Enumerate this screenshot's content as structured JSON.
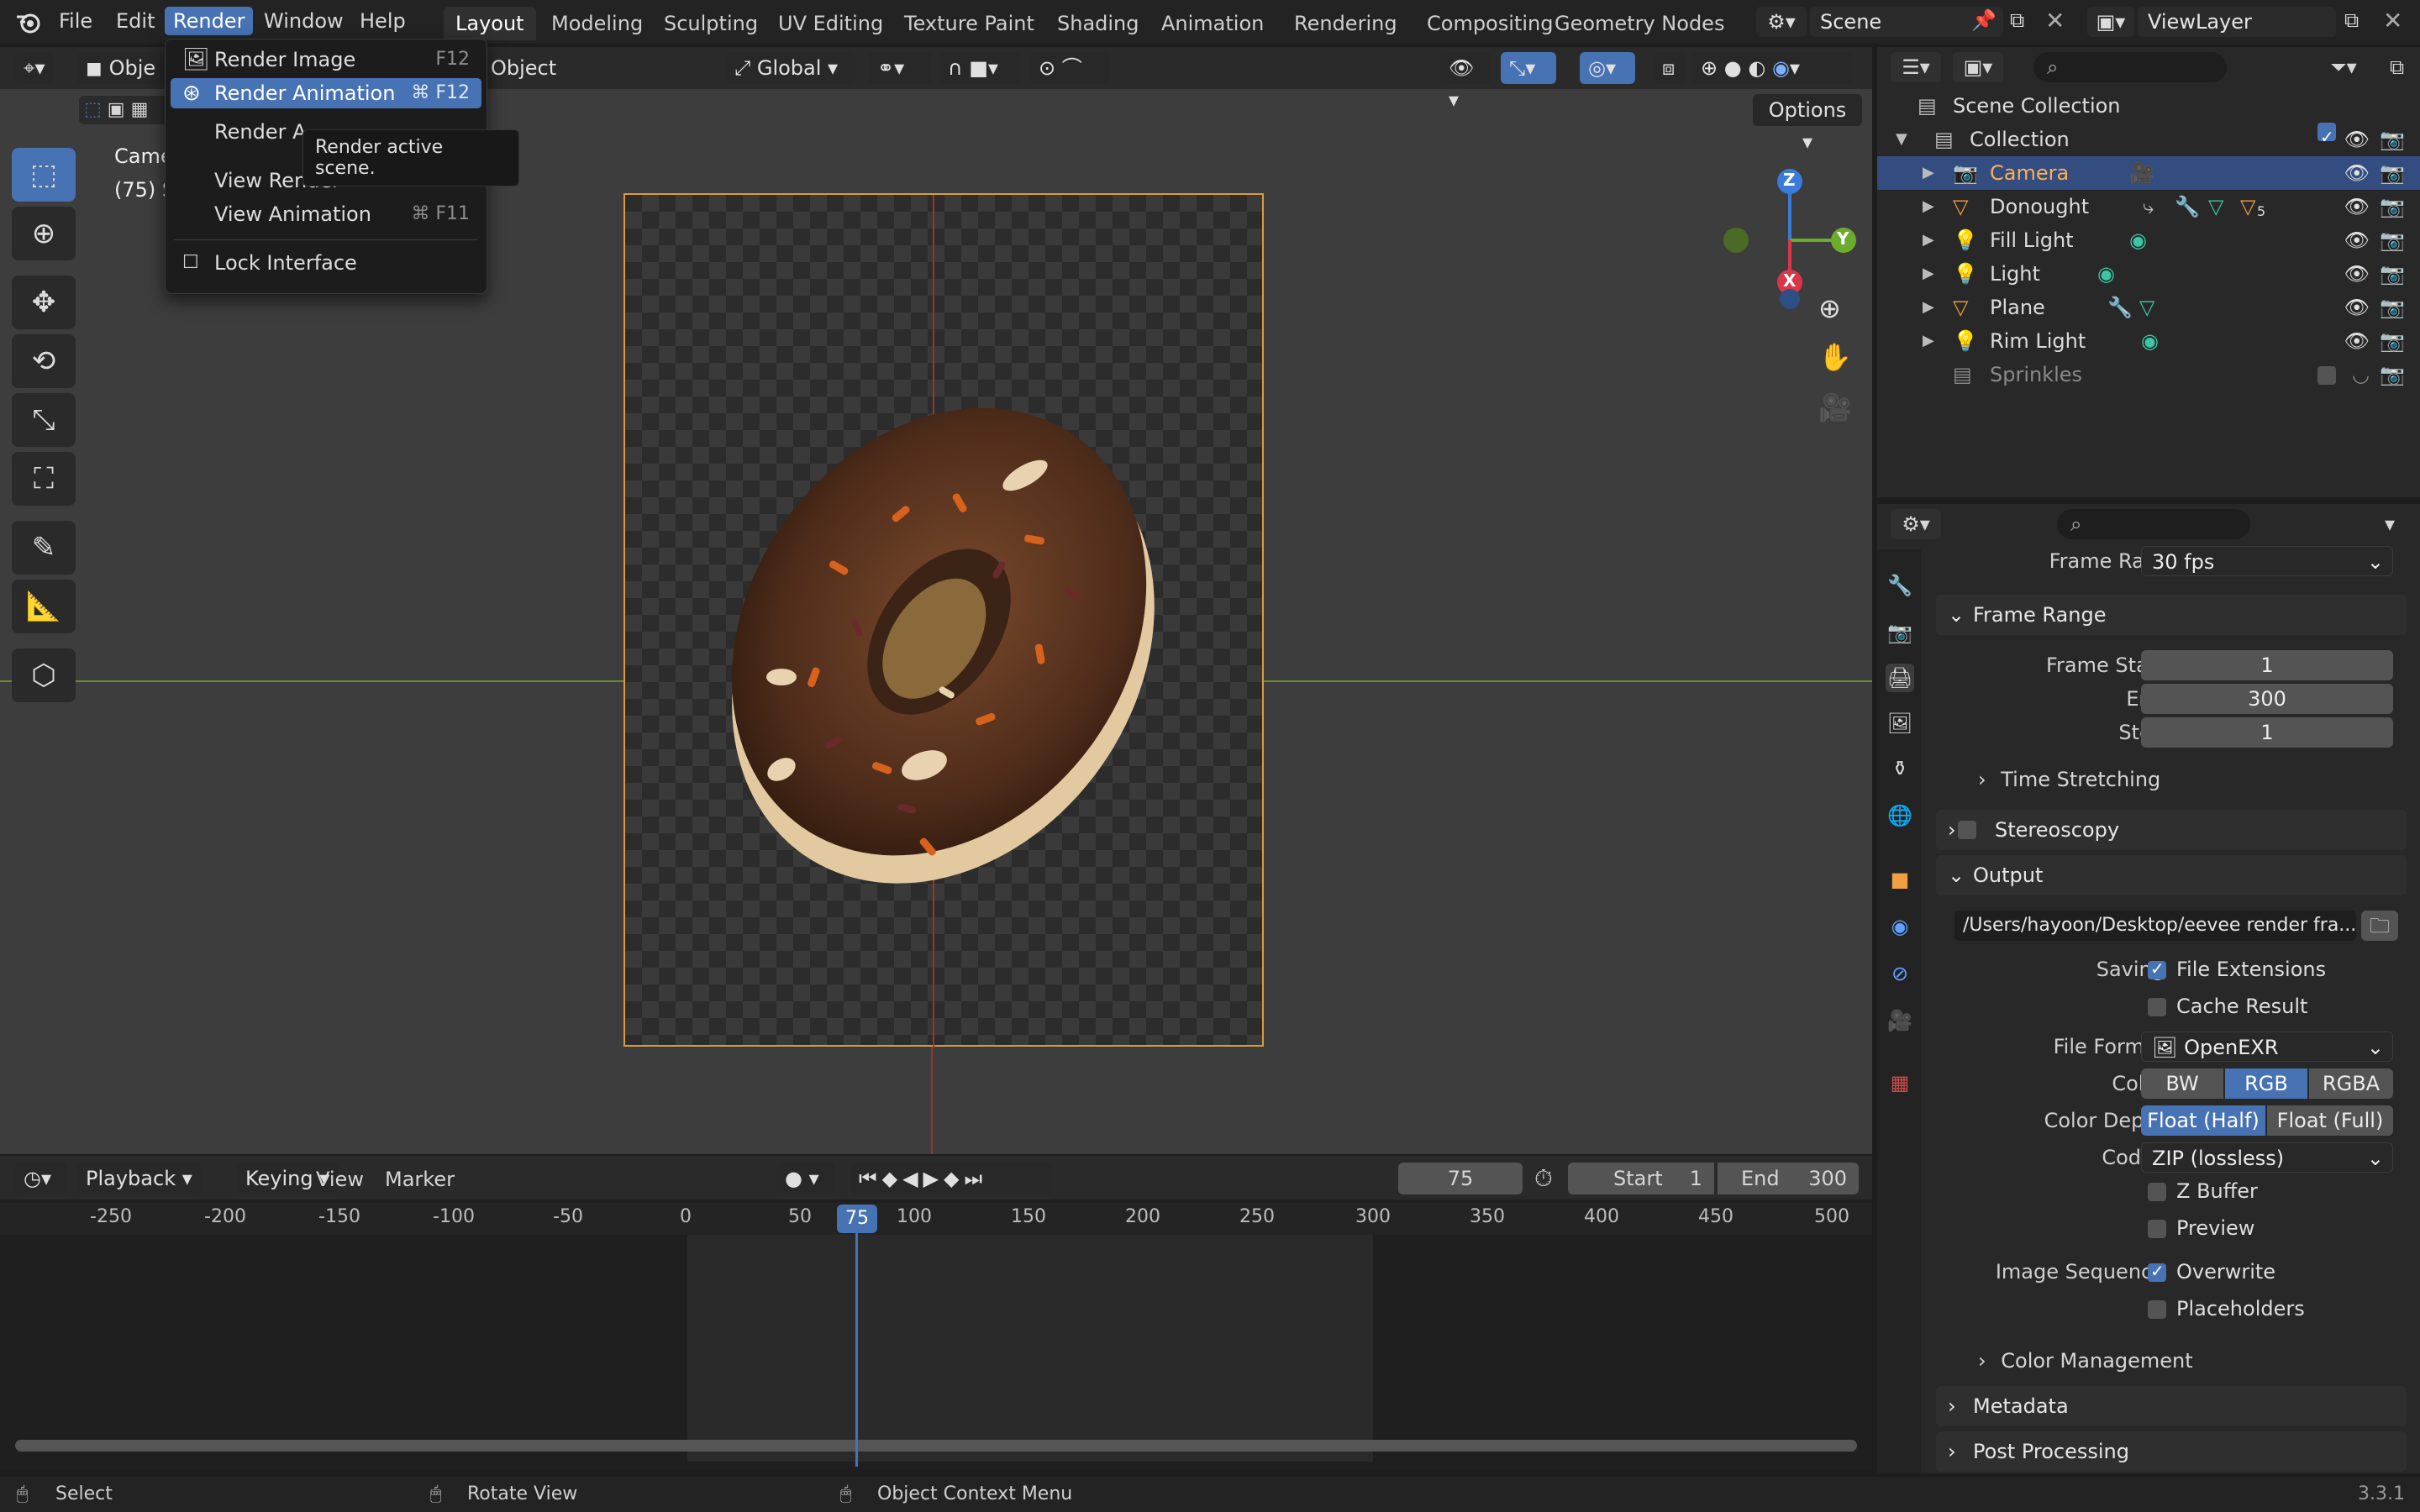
{
  "top_menu": [
    "File",
    "Edit",
    "Render",
    "Window",
    "Help"
  ],
  "workspace_tabs": [
    "Layout",
    "Modeling",
    "Sculpting",
    "UV Editing",
    "Texture Paint",
    "Shading",
    "Animation",
    "Rendering",
    "Compositing",
    "Geometry Nodes"
  ],
  "scene": "Scene",
  "view_layer": "ViewLayer",
  "viewport": {
    "mode_label": "Obje",
    "object_menu": "Object",
    "orientation": "Global",
    "options": "Options",
    "overlay_title": "Came",
    "overlay_frame": "(75) S"
  },
  "render_menu": {
    "items": [
      {
        "label": "Render Image",
        "shortcut": "F12"
      },
      {
        "label": "Render Animation",
        "shortcut": "⌘ F12"
      },
      {
        "label": "Render A",
        "shortcut": ""
      },
      {
        "label": "View Render",
        "shortcut": "F11"
      },
      {
        "label": "View Animation",
        "shortcut": "⌘ F11"
      },
      {
        "label": "Lock Interface",
        "shortcut": ""
      }
    ],
    "tooltip": "Render active scene."
  },
  "gizmo": {
    "z": "Z",
    "y": "Y",
    "x": "X"
  },
  "timeline": {
    "menus": [
      "Playback",
      "Keying",
      "View",
      "Marker"
    ],
    "current_frame": "75",
    "start_label": "Start",
    "start_value": "1",
    "end_label": "End",
    "end_value": "300",
    "ticks": [
      "-250",
      "-200",
      "-150",
      "-100",
      "-50",
      "0",
      "50",
      "100",
      "150",
      "200",
      "250",
      "300",
      "350",
      "400",
      "450",
      "500"
    ],
    "playhead": "75"
  },
  "status_bar": {
    "select": "Select",
    "rotate": "Rotate View",
    "context": "Object Context Menu",
    "version": "3.3.1"
  },
  "outliner": {
    "root": "Scene Collection",
    "collection": "Collection",
    "objects": [
      "Camera",
      "Donought",
      "Fill Light",
      "Light",
      "Plane",
      "Rim Light"
    ],
    "extra": "Sprinkles",
    "donut_modifier_count": "5"
  },
  "properties": {
    "frame_rate_label": "Frame Rate",
    "frame_rate": "30 fps",
    "frame_range": "Frame Range",
    "frame_start_label": "Frame Start",
    "frame_start": "1",
    "end_label": "End",
    "end": "300",
    "step_label": "Step",
    "step": "1",
    "time_stretching": "Time Stretching",
    "stereoscopy": "Stereoscopy",
    "output": "Output",
    "output_path": "/Users/hayoon/Desktop/eevee render fra...",
    "saving_label": "Saving",
    "file_extensions": "File Extensions",
    "cache_result": "Cache Result",
    "file_format_label": "File Format",
    "file_format": "OpenEXR",
    "color_label": "Color",
    "color_options": [
      "BW",
      "RGB",
      "RGBA"
    ],
    "color_depth_label": "Color Depth",
    "color_depth_options": [
      "Float (Half)",
      "Float (Full)"
    ],
    "codec_label": "Codec",
    "codec": "ZIP (lossless)",
    "z_buffer": "Z Buffer",
    "preview": "Preview",
    "image_sequence_label": "Image Sequence",
    "overwrite": "Overwrite",
    "placeholders": "Placeholders",
    "color_management": "Color Management",
    "metadata": "Metadata",
    "post_processing": "Post Processing"
  },
  "colors": {
    "accent": "#4772b3",
    "selected_text": "#ffaf4f",
    "camera_frame": "#d89c3c"
  }
}
